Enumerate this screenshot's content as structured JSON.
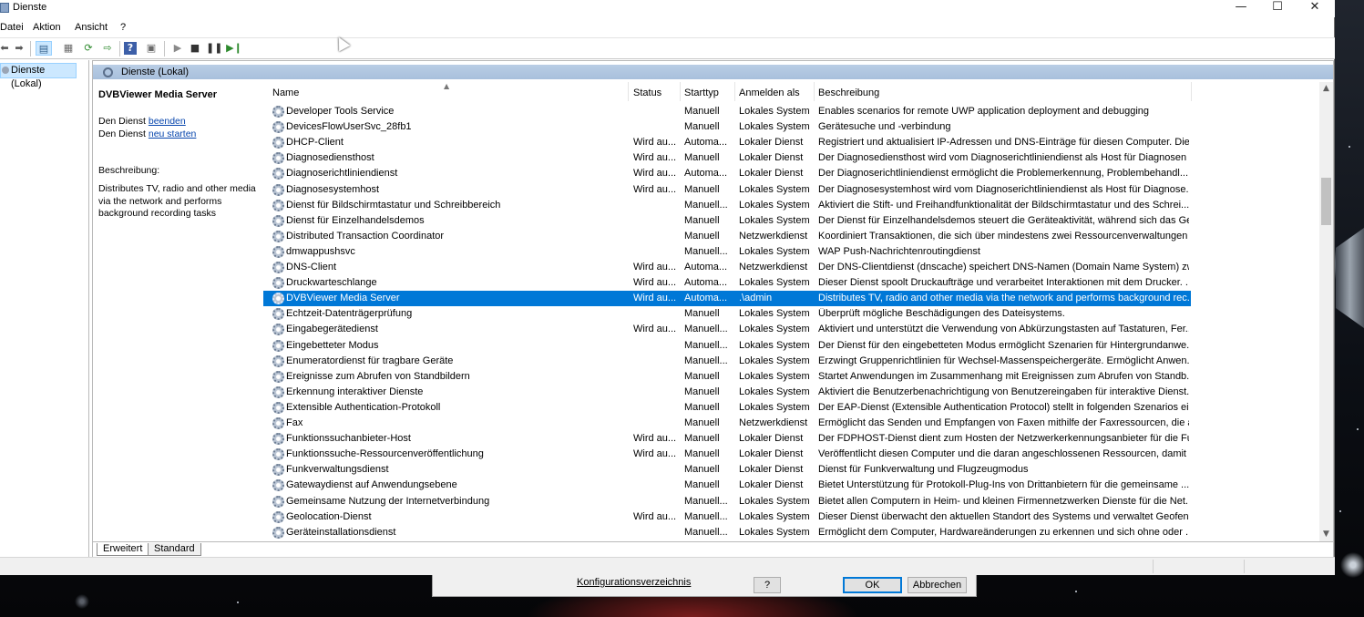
{
  "window": {
    "title": "Dienste",
    "controls": {
      "minimize": "—",
      "maximize": "☐",
      "close": "✕"
    }
  },
  "menu": [
    "Datei",
    "Aktion",
    "Ansicht",
    "?"
  ],
  "tree": {
    "selected_label": "Dienste (Lokal)"
  },
  "pane": {
    "header_title": "Dienste (Lokal)"
  },
  "details": {
    "service_name": "DVBViewer Media Server",
    "action1_prefix": "Den Dienst ",
    "action1_link": "beenden",
    "action2_prefix": "Den Dienst ",
    "action2_link": "neu starten",
    "description_label": "Beschreibung:",
    "description_text": "Distributes TV, radio and other media via the network and performs background recording tasks"
  },
  "columns": {
    "name": "Name",
    "status": "Status",
    "starttype": "Starttyp",
    "logon": "Anmelden als",
    "description": "Beschreibung"
  },
  "rows": [
    {
      "name": "Developer Tools Service",
      "status": "",
      "start": "Manuell",
      "logon": "Lokales System",
      "desc": "Enables scenarios for remote UWP application deployment and debugging"
    },
    {
      "name": "DevicesFlowUserSvc_28fb1",
      "status": "",
      "start": "Manuell",
      "logon": "Lokales System",
      "desc": "Gerätesuche und -verbindung"
    },
    {
      "name": "DHCP-Client",
      "status": "Wird au...",
      "start": "Automa...",
      "logon": "Lokaler Dienst",
      "desc": "Registriert und aktualisiert IP-Adressen und DNS-Einträge für diesen Computer. Die..."
    },
    {
      "name": "Diagnosediensthost",
      "status": "Wird au...",
      "start": "Manuell",
      "logon": "Lokaler Dienst",
      "desc": "Der Diagnosediensthost wird vom Diagnoserichtliniendienst als Host für Diagnosen ..."
    },
    {
      "name": "Diagnoserichtliniendienst",
      "status": "Wird au...",
      "start": "Automa...",
      "logon": "Lokaler Dienst",
      "desc": "Der Diagnoserichtliniendienst ermöglicht die Problemerkennung,  Problembehandl..."
    },
    {
      "name": "Diagnosesystemhost",
      "status": "Wird au...",
      "start": "Manuell",
      "logon": "Lokales System",
      "desc": "Der Diagnosesystemhost wird vom Diagnoserichtliniendienst als Host für Diagnose..."
    },
    {
      "name": "Dienst für Bildschirmtastatur und Schreibbereich",
      "status": "",
      "start": "Manuell...",
      "logon": "Lokales System",
      "desc": "Aktiviert die Stift- und Freihandfunktionalität der Bildschirmtastatur und des Schrei..."
    },
    {
      "name": "Dienst für Einzelhandelsdemos",
      "status": "",
      "start": "Manuell",
      "logon": "Lokales System",
      "desc": "Der Dienst für Einzelhandelsdemos steuert die Geräteaktivität, während sich das Ger..."
    },
    {
      "name": "Distributed Transaction Coordinator",
      "status": "",
      "start": "Manuell",
      "logon": "Netzwerkdienst",
      "desc": "Koordiniert Transaktionen, die sich über mindestens zwei Ressourcenverwaltungen ..."
    },
    {
      "name": "dmwappushsvc",
      "status": "",
      "start": "Manuell...",
      "logon": "Lokales System",
      "desc": "WAP Push-Nachrichtenroutingdienst"
    },
    {
      "name": "DNS-Client",
      "status": "Wird au...",
      "start": "Automa...",
      "logon": "Netzwerkdienst",
      "desc": "Der DNS-Clientdienst (dnscache) speichert DNS-Namen (Domain Name System) zw..."
    },
    {
      "name": "Druckwarteschlange",
      "status": "Wird au...",
      "start": "Automa...",
      "logon": "Lokales System",
      "desc": "Dieser Dienst spoolt Druckaufträge und verarbeitet Interaktionen mit dem Drucker. ..."
    },
    {
      "name": "DVBViewer Media Server",
      "status": "Wird au...",
      "start": "Automa...",
      "logon": ".\\admin",
      "desc": "Distributes TV, radio and other media via the network and performs background rec...",
      "selected": true
    },
    {
      "name": "Echtzeit-Datenträgerprüfung",
      "status": "",
      "start": "Manuell",
      "logon": "Lokales System",
      "desc": "Überprüft mögliche Beschädigungen des Dateisystems."
    },
    {
      "name": "Eingabegerätedienst",
      "status": "Wird au...",
      "start": "Manuell...",
      "logon": "Lokales System",
      "desc": "Aktiviert und unterstützt die Verwendung von Abkürzungstasten auf Tastaturen, Fer..."
    },
    {
      "name": "Eingebetteter Modus",
      "status": "",
      "start": "Manuell...",
      "logon": "Lokales System",
      "desc": "Der Dienst für den eingebetteten Modus ermöglicht Szenarien für Hintergrundanwe..."
    },
    {
      "name": "Enumeratordienst für tragbare Geräte",
      "status": "",
      "start": "Manuell...",
      "logon": "Lokales System",
      "desc": "Erzwingt Gruppenrichtlinien für Wechsel-Massenspeichergeräte. Ermöglicht Anwen..."
    },
    {
      "name": "Ereignisse zum Abrufen von Standbildern",
      "status": "",
      "start": "Manuell",
      "logon": "Lokales System",
      "desc": "Startet Anwendungen im Zusammenhang mit Ereignissen zum Abrufen von Standb..."
    },
    {
      "name": "Erkennung interaktiver Dienste",
      "status": "",
      "start": "Manuell",
      "logon": "Lokales System",
      "desc": "Aktiviert die Benutzerbenachrichtigung von Benutzereingaben für interaktive Dienst..."
    },
    {
      "name": "Extensible Authentication-Protokoll",
      "status": "",
      "start": "Manuell",
      "logon": "Lokales System",
      "desc": "Der EAP-Dienst (Extensible Authentication Protocol) stellt in folgenden Szenarios ei..."
    },
    {
      "name": "Fax",
      "status": "",
      "start": "Manuell",
      "logon": "Netzwerkdienst",
      "desc": "Ermöglicht das Senden und Empfangen von Faxen mithilfe der Faxressourcen, die a..."
    },
    {
      "name": "Funktionssuchanbieter-Host",
      "status": "Wird au...",
      "start": "Manuell",
      "logon": "Lokaler Dienst",
      "desc": "Der FDPHOST-Dienst dient zum Hosten der Netzwerkerkennungsanbieter für die Fu..."
    },
    {
      "name": "Funktionssuche-Ressourcenveröffentlichung",
      "status": "Wird au...",
      "start": "Manuell",
      "logon": "Lokaler Dienst",
      "desc": "Veröffentlicht diesen Computer und die daran angeschlossenen Ressourcen, damit ..."
    },
    {
      "name": "Funkverwaltungsdienst",
      "status": "",
      "start": "Manuell",
      "logon": "Lokaler Dienst",
      "desc": "Dienst für Funkverwaltung und Flugzeugmodus"
    },
    {
      "name": "Gatewaydienst auf Anwendungsebene",
      "status": "",
      "start": "Manuell",
      "logon": "Lokaler Dienst",
      "desc": "Bietet Unterstützung für Protokoll-Plug-Ins von Drittanbietern für die gemeinsame ..."
    },
    {
      "name": "Gemeinsame Nutzung der Internetverbindung",
      "status": "",
      "start": "Manuell...",
      "logon": "Lokales System",
      "desc": "Bietet allen Computern in Heim- und kleinen Firmennetzwerken Dienste für die Net..."
    },
    {
      "name": "Geolocation-Dienst",
      "status": "Wird au...",
      "start": "Manuell...",
      "logon": "Lokales System",
      "desc": "Dieser Dienst überwacht den aktuellen Standort des Systems und verwaltet Geofenc..."
    },
    {
      "name": "Geräteinstallationsdienst",
      "status": "",
      "start": "Manuell...",
      "logon": "Lokales System",
      "desc": "Ermöglicht dem Computer, Hardwareänderungen zu erkennen und sich ohne oder ..."
    }
  ],
  "tabs": [
    "Erweitert",
    "Standard"
  ],
  "dialog": {
    "link": "Konfigurationsverzeichnis",
    "help": "?",
    "ok": "OK",
    "cancel": "Abbrechen"
  }
}
